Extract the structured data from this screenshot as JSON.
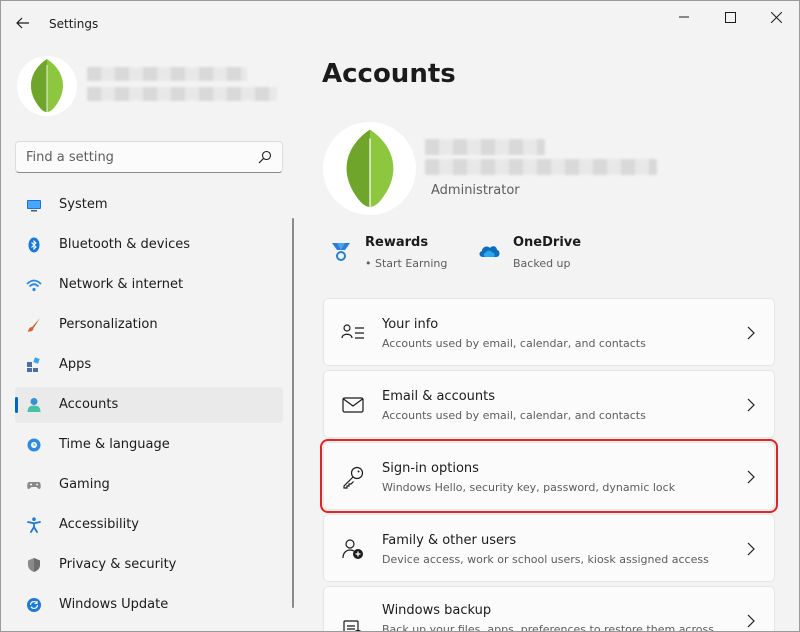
{
  "window": {
    "title": "Settings",
    "controls": [
      "minimize-icon",
      "maximize-icon",
      "close-icon"
    ]
  },
  "sidebar": {
    "search": {
      "placeholder": "Find a setting",
      "value": ""
    },
    "items": [
      {
        "label": "System",
        "icon": "system-icon",
        "active": false
      },
      {
        "label": "Bluetooth & devices",
        "icon": "bluetooth-icon",
        "active": false
      },
      {
        "label": "Network & internet",
        "icon": "wifi-icon",
        "active": false
      },
      {
        "label": "Personalization",
        "icon": "brush-icon",
        "active": false
      },
      {
        "label": "Apps",
        "icon": "apps-icon",
        "active": false
      },
      {
        "label": "Accounts",
        "icon": "person-icon",
        "active": true
      },
      {
        "label": "Time & language",
        "icon": "clock-globe-icon",
        "active": false
      },
      {
        "label": "Gaming",
        "icon": "gamepad-icon",
        "active": false
      },
      {
        "label": "Accessibility",
        "icon": "accessibility-icon",
        "active": false
      },
      {
        "label": "Privacy & security",
        "icon": "shield-icon",
        "active": false
      },
      {
        "label": "Windows Update",
        "icon": "update-icon",
        "active": false
      }
    ]
  },
  "main": {
    "title": "Accounts",
    "account": {
      "role": "Administrator"
    },
    "services": [
      {
        "title": "Rewards",
        "subtitle": "• Start Earning",
        "icon": "rewards-icon"
      },
      {
        "title": "OneDrive",
        "subtitle": "Backed up",
        "icon": "onedrive-cloud-icon"
      }
    ],
    "cards": [
      {
        "title": "Your info",
        "subtitle": "Accounts used by email, calendar, and contacts",
        "icon": "person-info-icon"
      },
      {
        "title": "Email & accounts",
        "subtitle": "Accounts used by email, calendar, and contacts",
        "icon": "mail-icon"
      },
      {
        "title": "Sign-in options",
        "subtitle": "Windows Hello, security key, password, dynamic lock",
        "icon": "key-icon",
        "highlighted": true
      },
      {
        "title": "Family & other users",
        "subtitle": "Device access, work or school users, kiosk assigned access",
        "icon": "family-add-icon"
      },
      {
        "title": "Windows backup",
        "subtitle": "Back up your files, apps, preferences to restore them across",
        "icon": "backup-icon"
      }
    ]
  },
  "colors": {
    "accent": "#0067c0",
    "highlight": "#e02323",
    "leaf": "#8dc63f"
  }
}
